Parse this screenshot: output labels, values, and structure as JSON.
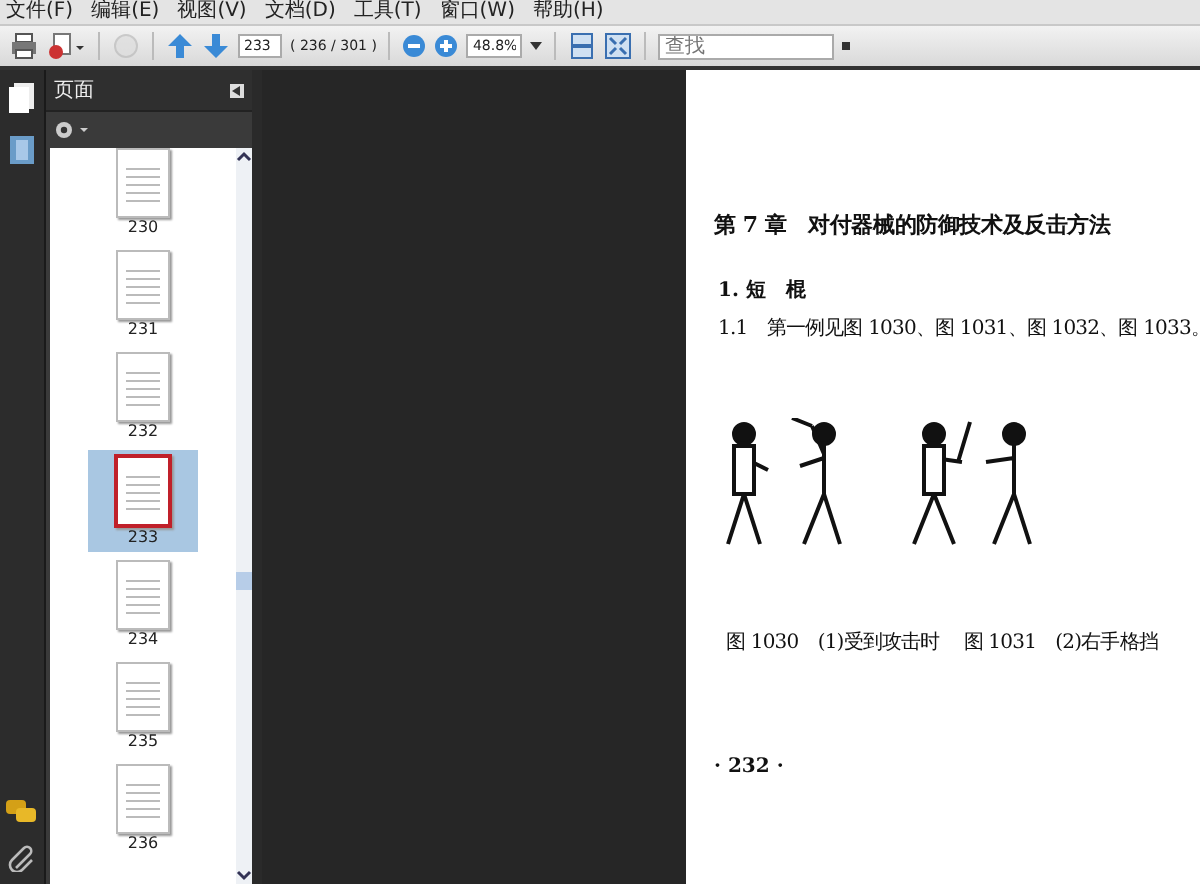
{
  "menu": [
    "文件(F)",
    "编辑(E)",
    "视图(V)",
    "文档(D)",
    "工具(T)",
    "窗口(W)",
    "帮助(H)"
  ],
  "toolbar": {
    "page_input": "233",
    "page_count": "( 236 / 301 )",
    "zoom": "48.8%",
    "search": {
      "placeholder": "查找"
    }
  },
  "panel": {
    "title": "页面"
  },
  "thumbnails": [
    {
      "label": "230",
      "selected": false
    },
    {
      "label": "231",
      "selected": false
    },
    {
      "label": "232",
      "selected": false
    },
    {
      "label": "233",
      "selected": true
    },
    {
      "label": "234",
      "selected": false
    },
    {
      "label": "235",
      "selected": false
    },
    {
      "label": "236",
      "selected": false
    }
  ],
  "document": {
    "chapter_title": "第 7 章　对付器械的防御技术及反击方法",
    "section": "1. 短　棍",
    "paragraph": "1.1　第一例见图 1030、图 1031、图 1032、图 1033。",
    "captions": [
      "图 1030　(1)受到攻击时",
      "图 1031　(2)右手格挡"
    ],
    "page_number": "· 232 ·"
  }
}
